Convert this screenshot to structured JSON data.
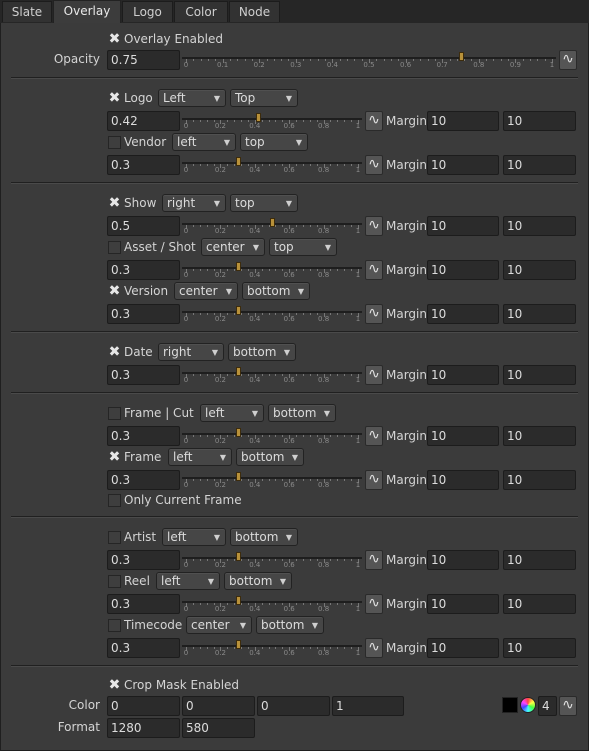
{
  "tabs": [
    "Slate",
    "Overlay",
    "Logo",
    "Color",
    "Node"
  ],
  "active_tab": "Overlay",
  "overlay": {
    "enabled_label": "Overlay Enabled",
    "enabled": true,
    "opacity_label": "Opacity",
    "opacity_value": "0.75",
    "opacity": 0.75
  },
  "slider_ticks": {
    "wide": [
      "0",
      "0.1",
      "0.2",
      "0.3",
      "0.4",
      "0.5",
      "0.6",
      "0.7",
      "0.8",
      "0.9",
      "1"
    ],
    "narrow": [
      "0",
      "0.2",
      "0.4",
      "0.6",
      "0.8",
      "1"
    ]
  },
  "margin_label": "Margin",
  "items": [
    {
      "label": "Logo",
      "checked": true,
      "h": "Left",
      "v": "Top",
      "value": "0.42",
      "level": 0.42,
      "margin_x": "10",
      "margin_y": "10"
    },
    {
      "label": "Vendor",
      "checked": false,
      "h": "left",
      "v": "top",
      "value": "0.3",
      "level": 0.3,
      "margin_x": "10",
      "margin_y": "10"
    },
    {
      "label": "Show",
      "checked": true,
      "h": "right",
      "v": "top",
      "value": "0.5",
      "level": 0.5,
      "margin_x": "10",
      "margin_y": "10"
    },
    {
      "label": "Asset / Shot",
      "checked": false,
      "h": "center",
      "v": "top",
      "value": "0.3",
      "level": 0.3,
      "margin_x": "10",
      "margin_y": "10"
    },
    {
      "label": "Version",
      "checked": true,
      "h": "center",
      "v": "bottom",
      "value": "0.3",
      "level": 0.3,
      "margin_x": "10",
      "margin_y": "10"
    },
    {
      "label": "Date",
      "checked": true,
      "h": "right",
      "v": "bottom",
      "value": "0.3",
      "level": 0.3,
      "margin_x": "10",
      "margin_y": "10"
    },
    {
      "label": "Frame | Cut",
      "checked": false,
      "h": "left",
      "v": "bottom",
      "value": "0.3",
      "level": 0.3,
      "margin_x": "10",
      "margin_y": "10"
    },
    {
      "label": "Frame",
      "checked": true,
      "h": "left",
      "v": "bottom",
      "value": "0.3",
      "level": 0.3,
      "margin_x": "10",
      "margin_y": "10"
    },
    {
      "label": "Artist",
      "checked": false,
      "h": "left",
      "v": "bottom",
      "value": "0.3",
      "level": 0.3,
      "margin_x": "10",
      "margin_y": "10"
    },
    {
      "label": "Reel",
      "checked": false,
      "h": "left",
      "v": "bottom",
      "value": "0.3",
      "level": 0.3,
      "margin_x": "10",
      "margin_y": "10"
    },
    {
      "label": "Timecode",
      "checked": false,
      "h": "center",
      "v": "bottom",
      "value": "0.3",
      "level": 0.3,
      "margin_x": "10",
      "margin_y": "10"
    }
  ],
  "only_current_frame": {
    "label": "Only Current Frame",
    "checked": false
  },
  "crop_mask": {
    "label": "Crop Mask Enabled",
    "checked": true
  },
  "color": {
    "label": "Color",
    "r": "0",
    "g": "0",
    "b": "0",
    "a": "1",
    "channels": "4",
    "red": "#b23a3a",
    "green": "#3a9a3a",
    "blue": "#3a5ab2"
  },
  "format": {
    "label": "Format",
    "width": "1280",
    "height": "580"
  },
  "colors": {
    "accent": "#b8913a",
    "panel": "#3b3b3b",
    "field": "#2b2b2b"
  }
}
